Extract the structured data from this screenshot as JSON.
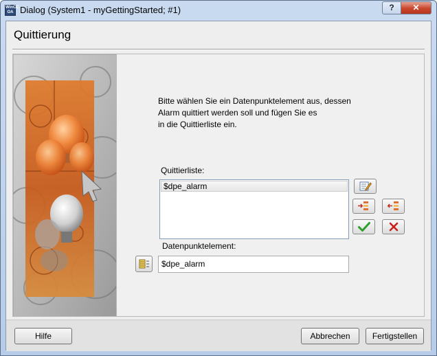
{
  "window": {
    "title": "Dialog (System1 - myGettingStarted; #1)",
    "app_icon_text": "WinCC OA",
    "help_button_label": "?",
    "close_button_label": "✕"
  },
  "page_title": "Quittierung",
  "intro_lines": [
    "Bitte wählen Sie ein Datenpunktelement aus, dessen",
    "Alarm quittiert werden soll und fügen Sie es",
    "in die Quittierliste ein."
  ],
  "quittierliste": {
    "label": "Quittierliste:",
    "items": [
      "$dpe_alarm"
    ]
  },
  "datenpunkt": {
    "label": "Datenpunktelement:",
    "value": "$dpe_alarm"
  },
  "side_buttons": [
    {
      "icon": "edit-icon"
    },
    {
      "icon": "add-to-list-icon"
    },
    {
      "icon": "remove-from-list-icon"
    },
    {
      "icon": "checkmark-icon"
    },
    {
      "icon": "delete-icon"
    }
  ],
  "footer": {
    "help_label": "Hilfe",
    "cancel_label": "Abbrechen",
    "finish_label": "Fertigstellen"
  },
  "colors": {
    "accept_green": "#2e9e2e",
    "delete_red": "#c8201c",
    "close_red": "#c9462c"
  }
}
